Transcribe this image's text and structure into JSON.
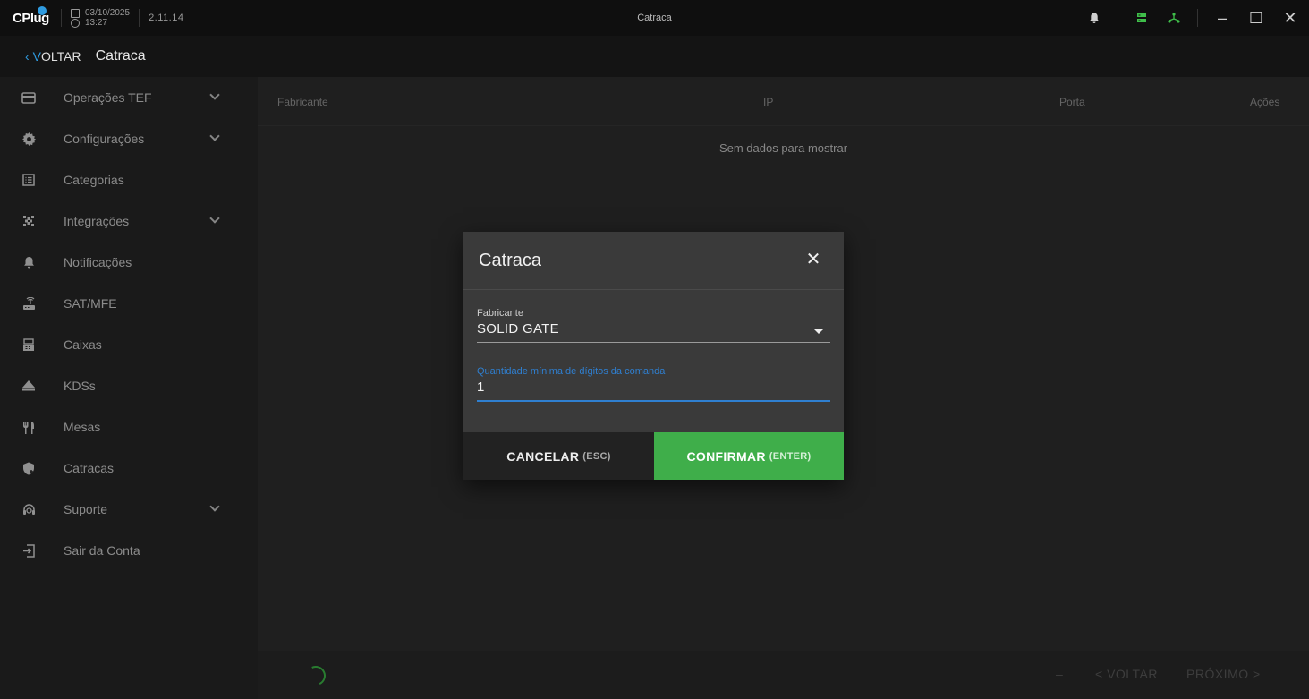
{
  "titlebar": {
    "logo_text": "CPlug",
    "date": "03/10/2025",
    "time": "13:27",
    "version": "2.11.14",
    "window_title": "Catraca",
    "minimize": "–",
    "maximize": "☐",
    "close": "✕"
  },
  "header": {
    "back_label": "VOLTAR",
    "back_first": "V",
    "back_rest": "OLTAR",
    "title": "Catraca"
  },
  "sidebar": {
    "items": [
      {
        "label": "Operações TEF",
        "icon": "card-icon",
        "expandable": true
      },
      {
        "label": "Configurações",
        "icon": "gear-icon",
        "expandable": true
      },
      {
        "label": "Categorias",
        "icon": "list-icon",
        "expandable": false
      },
      {
        "label": "Integrações",
        "icon": "puzzle-icon",
        "expandable": true
      },
      {
        "label": "Notificações",
        "icon": "bell-icon",
        "expandable": false
      },
      {
        "label": "SAT/MFE",
        "icon": "router-icon",
        "expandable": false
      },
      {
        "label": "Caixas",
        "icon": "cash-register-icon",
        "expandable": false
      },
      {
        "label": "KDSs",
        "icon": "eject-icon",
        "expandable": false
      },
      {
        "label": "Mesas",
        "icon": "utensils-icon",
        "expandable": false
      },
      {
        "label": "Catracas",
        "icon": "shield-plus-icon",
        "expandable": false
      },
      {
        "label": "Suporte",
        "icon": "headset-icon",
        "expandable": true
      },
      {
        "label": "Sair da Conta",
        "icon": "logout-icon",
        "expandable": false
      }
    ]
  },
  "table": {
    "columns": [
      "Fabricante",
      "IP",
      "Porta",
      "Ações"
    ],
    "empty_text": "Sem dados para mostrar"
  },
  "pagination": {
    "dash": "–",
    "prev": "< VOLTAR",
    "next": "PRÓXIMO >"
  },
  "dialog": {
    "title": "Catraca",
    "close_icon": "✕",
    "fabricante_label": "Fabricante",
    "fabricante_value": "SOLID GATE",
    "digits_label": "Quantidade mínima de dígitos da comanda",
    "digits_value": "1",
    "cancel_label": "CANCELAR",
    "cancel_hint": "(ESC)",
    "confirm_label": "CONFIRMAR",
    "confirm_hint": "(ENTER)"
  },
  "colors": {
    "accent_blue": "#2f9be0",
    "accent_green": "#3fae4a"
  }
}
